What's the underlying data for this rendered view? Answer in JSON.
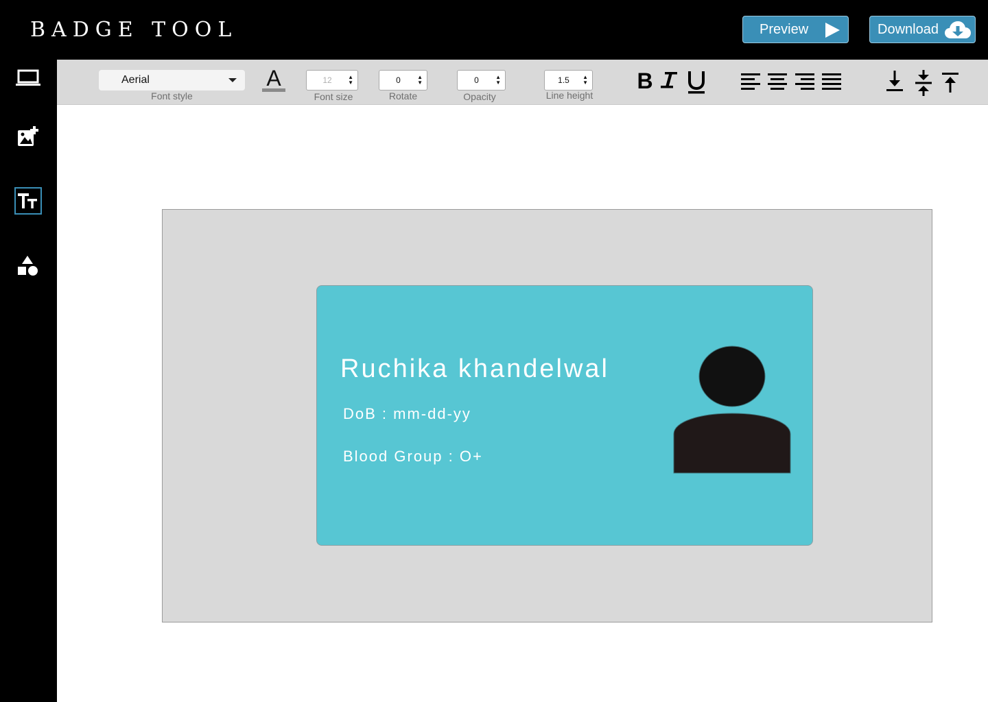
{
  "app": {
    "logo": "BADGE TOOL"
  },
  "header": {
    "preview_label": "Preview",
    "download_label": "Download"
  },
  "sidebar": {
    "items": [
      {
        "name": "background",
        "icon": "laptop-icon",
        "active": false
      },
      {
        "name": "add-image",
        "icon": "add-image-icon",
        "active": false
      },
      {
        "name": "text",
        "icon": "text-size-icon",
        "active": true
      },
      {
        "name": "shapes",
        "icon": "shapes-icon",
        "active": false
      }
    ]
  },
  "toolbar": {
    "font_style": {
      "value": "Aerial",
      "label": "Font style"
    },
    "font_color_glyph": "A",
    "font_size": {
      "value": "12",
      "label": "Font size"
    },
    "rotate": {
      "value": "0",
      "label": "Rotate"
    },
    "opacity": {
      "value": "0",
      "label": "Opacity"
    },
    "line_height": {
      "value": "1.5",
      "label": "Line height"
    },
    "format_icons": [
      "bold-icon",
      "italic-icon",
      "underline-icon"
    ],
    "align_icons": [
      "align-left-icon",
      "align-center-icon",
      "align-right-icon",
      "align-justify-icon"
    ],
    "valign_icons": [
      "valign-bottom-icon",
      "valign-middle-icon",
      "valign-top-icon"
    ]
  },
  "badge": {
    "name": "Ruchika khandelwal",
    "dob": "DoB : mm-dd-yy",
    "blood_group": "Blood Group : O+",
    "card_color": "#57c6d3",
    "avatar_icon": "person-silhouette-icon"
  },
  "colors": {
    "accent": "#3a8fb7",
    "topbar": "#000000",
    "toolbar": "#d9d9d9",
    "canvas": "#d9d9d9"
  }
}
